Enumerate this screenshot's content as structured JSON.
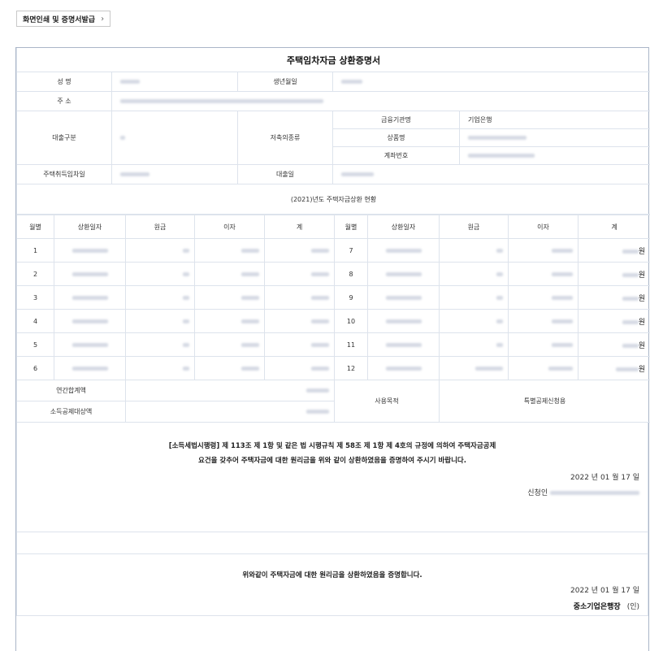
{
  "toolbar": {
    "print_label": "화면인쇄 및 증명서발급",
    "chevron": "›"
  },
  "doc": {
    "title": "주택임차자금 상환증명서",
    "labels": {
      "name": "성 명",
      "birth": "생년월일",
      "address": "주 소",
      "loan_type": "대출구분",
      "savings_type": "저축의종류",
      "institution": "금융기관명",
      "product": "상품명",
      "account": "계좌번호",
      "acquisition_date": "주택취득임차일",
      "loan_date": "대출일"
    },
    "values": {
      "institution": "기업은행"
    },
    "section_title": "(2021)년도 주택자금상환 현황",
    "columns": [
      "월별",
      "상환일자",
      "원금",
      "이자",
      "계"
    ],
    "months_left": [
      "1",
      "2",
      "3",
      "4",
      "5",
      "6"
    ],
    "months_right": [
      "7",
      "8",
      "9",
      "10",
      "11",
      "12"
    ],
    "won": "원",
    "annual_total": "연간합계액",
    "deduction_amount": "소득공제대상액",
    "purpose_label": "사용목적",
    "purpose_value": "특별공제신청용",
    "statement_line1": "[소득세법시행령] 제 113조 제 1항 및 같은 법 시행규칙 제 58조 제 1항 제 4호의 규정에 의하여 주택자금공제",
    "statement_line2": "요건을 갖추어 주택자금에 대한 원리금을 위와 같이 상환하였음을 증명하여 주시기 바랍니다.",
    "date": "2022 년 01 월 17 일",
    "applicant_label": "신청인",
    "cert_line": "위와같이 주택자금에 대한 원리금을 상환하였음을 증명합니다.",
    "issuer": "중소기업은행장",
    "seal": "(인)"
  }
}
